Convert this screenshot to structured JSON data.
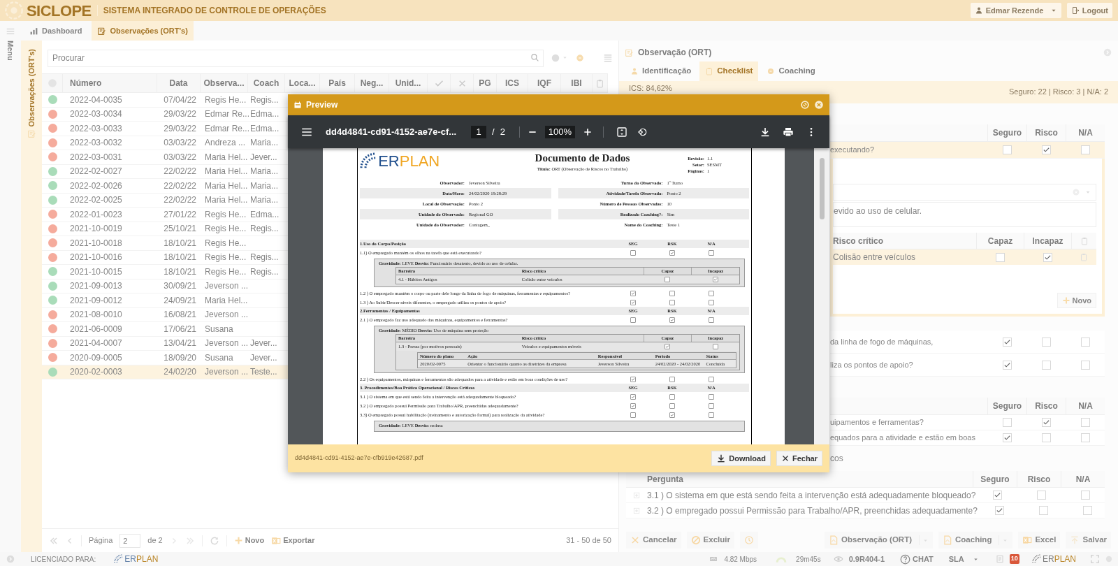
{
  "header": {
    "logo": "SICLOPE",
    "subtitle": "SISTEMA INTEGRADO DE CONTROLE DE OPERAÇÕES",
    "user": "Edmar Rezende",
    "logout": "Logout"
  },
  "sidebar": {
    "label": "Menu"
  },
  "tabs": [
    {
      "label": "Dashboard",
      "selected": false
    },
    {
      "label": "Observações (ORT's)",
      "selected": true
    }
  ],
  "list_panel": {
    "side_label": "Observações (ORT's)",
    "search": {
      "placeholder": "Procurar"
    },
    "columns": [
      {
        "kind": "status"
      },
      {
        "kind": "text",
        "label": "Número"
      },
      {
        "kind": "text",
        "label": "Data"
      },
      {
        "kind": "text",
        "label": "Observa..."
      },
      {
        "kind": "text",
        "label": "Coach"
      },
      {
        "kind": "text",
        "label": "Loca..."
      },
      {
        "kind": "text",
        "label": "País"
      },
      {
        "kind": "text",
        "label": "Neg..."
      },
      {
        "kind": "text",
        "label": "Unid..."
      },
      {
        "kind": "check"
      },
      {
        "kind": "cross"
      },
      {
        "kind": "text",
        "label": "PG"
      },
      {
        "kind": "text",
        "label": "ICS"
      },
      {
        "kind": "text",
        "label": "IQF"
      },
      {
        "kind": "text",
        "label": "IBI"
      },
      {
        "kind": "clipboard"
      }
    ],
    "rows": [
      {
        "color": "#a9dcb9",
        "number": "2022-04-0035",
        "date": "07/04/22",
        "observer": "Regis He...",
        "coach": "Regis...",
        "selected": false
      },
      {
        "color": "#f5ab9c",
        "number": "2022-03-0034",
        "date": "29/03/22",
        "observer": "Edmar Re...",
        "coach": "Edma...",
        "selected": false
      },
      {
        "color": "#f5ab9c",
        "number": "2022-03-0033",
        "date": "29/03/22",
        "observer": "Edmar Re...",
        "coach": "Edma...",
        "selected": false
      },
      {
        "color": "#f5ab9c",
        "number": "2022-03-0032",
        "date": "03/03/22",
        "observer": "Andreza ...",
        "coach": "Maria...",
        "selected": false
      },
      {
        "color": "#f5ab9c",
        "number": "2022-03-0031",
        "date": "03/03/22",
        "observer": "Maria Hel...",
        "coach": "Jever...",
        "selected": false
      },
      {
        "color": "#a9dcb9",
        "number": "2022-02-0027",
        "date": "22/02/22",
        "observer": "Maria Hel...",
        "coach": "Maria...",
        "selected": false
      },
      {
        "color": "#a9dcb9",
        "number": "2022-02-0026",
        "date": "22/02/22",
        "observer": "Maria Hel...",
        "coach": "Maria...",
        "selected": false
      },
      {
        "color": "#a9dcb9",
        "number": "2022-02-0025",
        "date": "22/02/22",
        "observer": "Maria Hel...",
        "coach": "Maria...",
        "selected": false
      },
      {
        "color": "#f5ab9c",
        "number": "2022-01-0023",
        "date": "27/01/22",
        "observer": "Regis He...",
        "coach": "Edma...",
        "selected": false
      },
      {
        "color": "#f5ab9c",
        "number": "2021-10-0019",
        "date": "25/10/21",
        "observer": "Regis He...",
        "coach": "Regis...",
        "selected": false
      },
      {
        "color": "#f5ab9c",
        "number": "2021-10-0018",
        "date": "18/10/21",
        "observer": "Regis He...",
        "selected": false
      },
      {
        "color": "#f5ab9c",
        "number": "2021-10-0016",
        "date": "18/10/21",
        "observer": "Regis He...",
        "coach": "Regis...",
        "selected": false
      },
      {
        "color": "#a9dcb9",
        "number": "2021-10-0015",
        "date": "18/10/21",
        "observer": "Regis He...",
        "coach": "Regis...",
        "selected": false
      },
      {
        "color": "#a9dcb9",
        "number": "2021-09-0013",
        "date": "30/09/21",
        "observer": "Jeverson ...",
        "selected": false
      },
      {
        "color": "#a9dcb9",
        "number": "2021-09-0012",
        "date": "24/09/21",
        "observer": "Maria Hel...",
        "selected": false
      },
      {
        "color": "#f5ab9c",
        "number": "2021-08-0010",
        "date": "16/08/21",
        "observer": "Jeverson ...",
        "selected": false
      },
      {
        "color": "#f5ab9c",
        "number": "2021-06-0009",
        "date": "17/06/21",
        "observer": "Susana",
        "selected": false
      },
      {
        "color": "#f5ab9c",
        "number": "2021-04-0007",
        "date": "13/04/21",
        "observer": "Jeverson ...",
        "coach": "Jever...",
        "selected": false
      },
      {
        "color": "#f5ab9c",
        "number": "2020-09-0005",
        "date": "18/09/20",
        "observer": "Susana",
        "coach": "Jever...",
        "selected": false
      },
      {
        "color": "#a9dcb9",
        "number": "2020-02-0003",
        "date": "24/02/20",
        "observer": "Jeverson ...",
        "coach": "Teste...",
        "selected": true
      }
    ],
    "pager": {
      "page_label": "Página",
      "page": "2",
      "of": "de 2",
      "new": "Novo",
      "export": "Exportar",
      "range": "31 - 50 de 50"
    }
  },
  "detail_panel": {
    "title": "Observação (ORT)",
    "tabs": [
      {
        "label": "Identificação",
        "selected": false
      },
      {
        "label": "Checklist",
        "selected": true
      },
      {
        "label": "Coaching",
        "selected": false
      }
    ],
    "ics": "ICS: 84,62%",
    "summary": "Seguro: 22 | Risco: 3 | N/A: 2",
    "groups": [
      {
        "columns": [
          "Seguro",
          "Risco",
          "N/A"
        ],
        "rows": [
          {
            "text": "executando?",
            "checks": [
              false,
              true,
              false
            ],
            "selected": true,
            "deviation": {
              "description": "evido ao uso de celular.",
              "barrier_columns": [
                "Risco crítico",
                "Capaz",
                "Incapaz"
              ],
              "barriers": [
                {
                  "risk": "Colisão entre veículos",
                  "checks": [
                    false,
                    true
                  ],
                  "selected": true
                }
              ],
              "new_button": "Novo"
            }
          },
          {
            "text": "da linha de fogo de máquinas,",
            "checks": [
              true,
              false,
              false
            ],
            "selected": false
          },
          {
            "text": "liza os pontos de apoio?",
            "checks": [
              true,
              false,
              false
            ],
            "selected": false
          }
        ]
      },
      {
        "columns": [
          "Seguro",
          "Risco",
          "N/A"
        ],
        "rows": [
          {
            "text": "uipamentos e ferramentas?",
            "checks": [
              false,
              true,
              false
            ],
            "selected": false
          },
          {
            "text": "equados para a atividade e estão em boas",
            "checks": [
              true,
              false,
              false
            ],
            "selected": false
          }
        ]
      }
    ],
    "section_tail": "cos",
    "lower": {
      "question_label": "Pergunta",
      "columns": [
        "Seguro",
        "Risco",
        "N/A"
      ],
      "rows": [
        {
          "text": "3.1 ) O sistema em que está sendo feita a intervenção está adequadamente bloqueado?",
          "checks": [
            true,
            false,
            false
          ]
        },
        {
          "text": "3.2 ) O empregado possui Permissão para Trabalho/APR, preenchidas adequadamente?",
          "checks": [
            true,
            false,
            false
          ]
        }
      ]
    },
    "actions": {
      "cancel": "Cancelar",
      "delete": "Excluir",
      "report": "Observação (ORT)",
      "coaching": "Coaching",
      "excel": "Excel",
      "save": "Salvar"
    }
  },
  "footer": {
    "licensed": "LICENCIADO PARA:",
    "logo": [
      "ER",
      "PLAN"
    ],
    "speed": "4.82 Mbps",
    "timer": "29m45s",
    "version": "0.9R404-1",
    "chat": "CHAT",
    "sla": "SLA",
    "badge": "10",
    "logo_right": [
      "ER",
      "PLAN"
    ]
  },
  "preview": {
    "title": "Preview",
    "toolbar": {
      "filename": "dd4d4841-cd91-4152-ae7e-cf...",
      "page": "1",
      "separator": "/",
      "pages": "2",
      "zoom": "100%"
    },
    "document": {
      "logo": [
        "ER",
        "PLAN"
      ],
      "title": "Documento de Dados",
      "subtitle": "**Titulo:** ORT (Observação de Riscos no Trabalho)",
      "meta": [
        {
          "label": "Revisão:",
          "value": "1.1"
        },
        {
          "label": "Setor:",
          "value": "SESMT"
        },
        {
          "label": "Páginas:",
          "value": "1"
        }
      ],
      "fields": [
        [
          {
            "label": "Observador:",
            "value": "Jeverson Silveira"
          },
          {
            "label": "Turno do Observado:",
            "value": "1º Turno"
          }
        ],
        [
          {
            "label": "Data/Hora:",
            "value": "24/02/2020 19:28:29"
          },
          {
            "label": "Atividade/Tarefa Observada:",
            "value": "Ponto 2"
          }
        ],
        [
          {
            "label": "Local de Observação:",
            "value": "Ponto 2"
          },
          {
            "label": "Número de Pessoas Observadas:",
            "value": "10"
          }
        ],
        [
          {
            "label": "Unidade do Observado:",
            "value": "Regional GO"
          },
          {
            "label": "Realizado Coaching?:",
            "value": "Sim"
          }
        ],
        [
          {
            "label": "Unidade do Observador:",
            "value": "Contagem_"
          },
          {
            "label": "Nome do Coaching:",
            "value": "Teste 1"
          }
        ]
      ],
      "items": [
        {
          "kind": "section",
          "text": "1.Uso do Corpo/Posição",
          "columns": [
            "SEG",
            "RSK",
            "N/A"
          ]
        },
        {
          "kind": "question",
          "text": "1.1) O empregado mantém os olhos na tarefa que está executando?",
          "checks": [
            false,
            true,
            false
          ]
        },
        {
          "kind": "deviation",
          "summary": "**Gravidade:** LEVE **Desvio:** Funcionário desatento, devido ao uso de celular.",
          "barrier_columns": [
            "Barreira",
            "Risco crítico",
            "Capaz",
            "Incapaz"
          ],
          "barriers": [
            {
              "barrier": "4.1 - Hábitos Antigos",
              "risk": "Colisão entre veiculos",
              "checks": [
                false,
                true
              ]
            }
          ]
        },
        {
          "kind": "question",
          "text": "1.2 ) O empregado mantém o corpo ou parte dele longe da linha de fogo de máquinas, ferramentas e equipamentos?",
          "checks": [
            true,
            false,
            false
          ]
        },
        {
          "kind": "question",
          "text": "1.3 ) Ao Subir/Descer níveis diferentes, o empregado utiliza os pontos de apoio?",
          "checks": [
            true,
            false,
            false
          ]
        },
        {
          "kind": "section",
          "text": "2.Ferramentas / Equipamentos",
          "columns": [
            "SEG",
            "RSK",
            "N/A"
          ]
        },
        {
          "kind": "question",
          "text": "2.1 ) O empregado faz uso adequado das máquinas, equipamentos e ferramentas?",
          "checks": [
            false,
            true,
            false
          ]
        },
        {
          "kind": "deviation",
          "summary": "**Gravidade:** MÉDIO **Desvio:** Uso de máquina sem proteção",
          "barrier_columns": [
            "Barreira",
            "Risco crítico",
            "Capaz",
            "Incapaz"
          ],
          "barriers": [
            {
              "barrier": "1.3 - Pressa (por motivos pessoais)",
              "risk": "Veículos e equipamentos móveis",
              "checks": [
                true,
                false
              ],
              "plan_columns": [
                "Número do plano",
                "Ação",
                "Responsável",
                "Período",
                "Status"
              ],
              "plans": [
                [
                  "2020/02-0075",
                  "Orientar o funcionário quanto as diretrizes da empresa",
                  "Jeverson Silveira",
                  "24/02/2020 - 24/02/2020",
                  "Concluída"
                ]
              ]
            }
          ]
        },
        {
          "kind": "question",
          "text": "2.2 ) Os equipamentos, máquinas e ferramentas são adequados para a atividade e estão em boas condições de uso?",
          "checks": [
            true,
            false,
            false
          ]
        },
        {
          "kind": "section",
          "text": "3. Procedimentos/Boa Prática Operacional / Riscos Críticos",
          "columns": [
            "SEG",
            "RSK",
            "N/A"
          ]
        },
        {
          "kind": "question",
          "text": "3.1 ) O sistema em que está sendo feita a intervenção está adequadamente bloqueado?",
          "checks": [
            true,
            false,
            false
          ]
        },
        {
          "kind": "question",
          "text": "3.2 ) O empregado possui Permissão para Trabalho/APR, preenchidas adequadamente?",
          "checks": [
            true,
            false,
            false
          ]
        },
        {
          "kind": "question",
          "text": "3.3) O empregado possui habilitação (treinamento e autorização formal) para realização da atividade?",
          "checks": [
            false,
            true,
            false
          ]
        },
        {
          "kind": "deviation",
          "summary": "**Gravidade:** LEVE **Desvio:** nsdnsa"
        }
      ]
    },
    "footer": {
      "filename": "dd4d4841-cd91-4152-ae7e-cfb919e42687.pdf",
      "download": "Download",
      "close": "Fechar"
    }
  }
}
